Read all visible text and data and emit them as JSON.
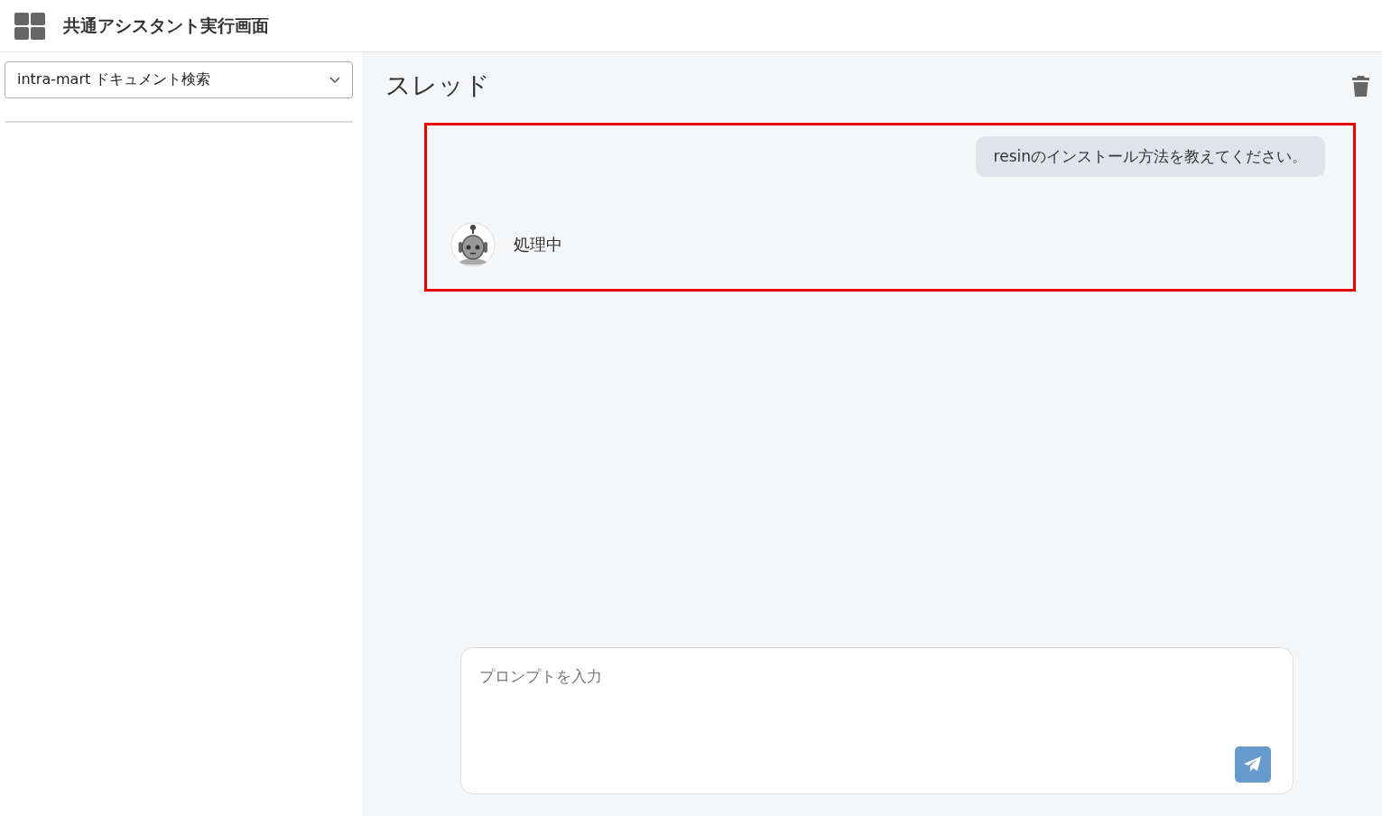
{
  "header": {
    "title": "共通アシスタント実行画面"
  },
  "sidebar": {
    "assistant_select": {
      "value": "intra-mart ドキュメント検索"
    }
  },
  "thread": {
    "title": "スレッド",
    "highlighted": true,
    "messages": [
      {
        "kind": "user",
        "text": "resinのインストール方法を教えてください。"
      },
      {
        "kind": "bot",
        "text": "処理中"
      }
    ]
  },
  "prompt": {
    "placeholder": "プロンプトを入力"
  }
}
